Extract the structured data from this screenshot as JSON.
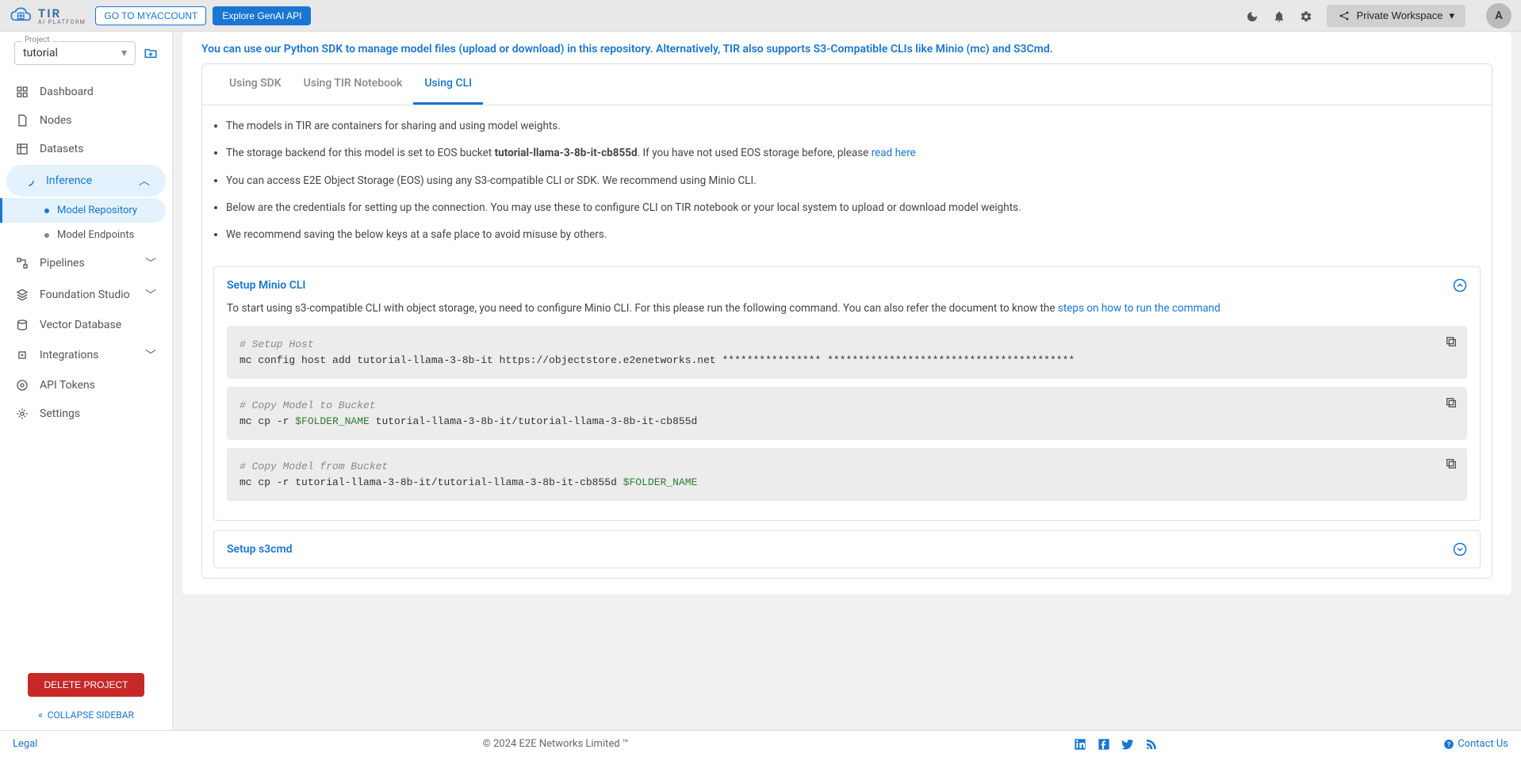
{
  "header": {
    "logo_text": "TIR",
    "logo_sub": "AI PLATFORM",
    "myaccount": "GO TO MYACCOUNT",
    "explore": "Explore GenAI API",
    "workspace": "Private Workspace",
    "avatar": "A"
  },
  "sidebar": {
    "project_label": "Project",
    "project_value": "tutorial",
    "items": {
      "dashboard": "Dashboard",
      "nodes": "Nodes",
      "datasets": "Datasets",
      "inference": "Inference",
      "model_repo": "Model Repository",
      "model_endpoints": "Model Endpoints",
      "pipelines": "Pipelines",
      "foundation": "Foundation Studio",
      "vectordb": "Vector Database",
      "integrations": "Integrations",
      "api_tokens": "API Tokens",
      "settings": "Settings"
    },
    "delete": "DELETE PROJECT",
    "collapse": "COLLAPSE SIDEBAR"
  },
  "main": {
    "intro": "You can use our Python SDK to manage model files (upload or download) in this repository. Alternatively, TIR also supports S3-Compatible CLIs like Minio (mc) and S3Cmd.",
    "tabs": {
      "sdk": "Using SDK",
      "notebook": "Using TIR Notebook",
      "cli": "Using CLI"
    },
    "bullets": {
      "b1": "The models in TIR are containers for sharing and using model weights.",
      "b2a": "The storage backend for this model is set to EOS bucket ",
      "b2b": "tutorial-llama-3-8b-it-cb855d",
      "b2c": ". If you have not used EOS storage before, please ",
      "b2d": "read here",
      "b3": "You can access E2E Object Storage (EOS) using any S3-compatible CLI or SDK. We recommend using Minio CLI.",
      "b4": "Below are the credentials for setting up the connection. You may use these to configure CLI on TIR notebook or your local system to upload or download model weights.",
      "b5": "We recommend saving the below keys at a safe place to avoid misuse by others."
    },
    "accordion1": {
      "title": "Setup Minio CLI",
      "desc_a": "To start using s3-compatible CLI with object storage, you need to configure Minio CLI. For this please run the following command. You can also refer the document to know the ",
      "desc_link": "steps on how to run the command",
      "code1_comment": "# Setup Host",
      "code1_cmd": "mc config host add tutorial-llama-3-8b-it https://objectstore.e2enetworks.net **************** ****************************************",
      "code2_comment": "# Copy Model to Bucket",
      "code2_a": "mc cp -r ",
      "code2_var": "$FOLDER_NAME",
      "code2_b": " tutorial-llama-3-8b-it/tutorial-llama-3-8b-it-cb855d",
      "code3_comment": "# Copy Model from Bucket",
      "code3_a": "mc cp -r tutorial-llama-3-8b-it/tutorial-llama-3-8b-it-cb855d ",
      "code3_var": "$FOLDER_NAME"
    },
    "accordion2": {
      "title": "Setup s3cmd"
    }
  },
  "footer": {
    "legal": "Legal",
    "copyright": "© 2024 E2E Networks Limited ™",
    "contact": "Contact Us"
  }
}
